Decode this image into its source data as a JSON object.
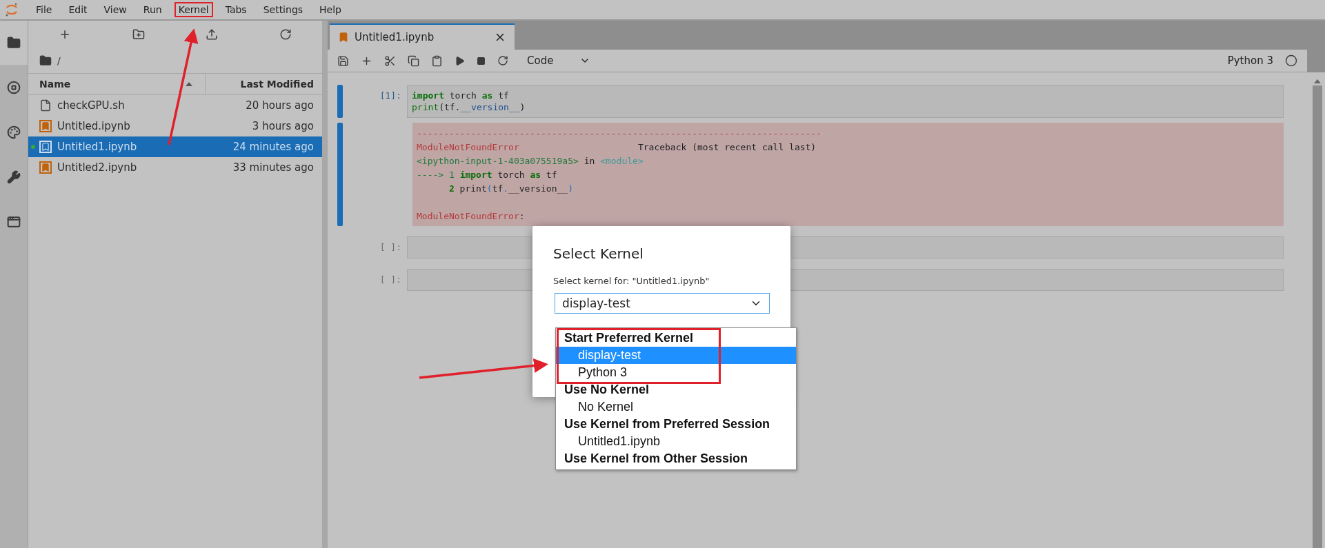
{
  "menu": [
    {
      "label": "File",
      "highlighted": false
    },
    {
      "label": "Edit",
      "highlighted": false
    },
    {
      "label": "View",
      "highlighted": false
    },
    {
      "label": "Run",
      "highlighted": false
    },
    {
      "label": "Kernel",
      "highlighted": true
    },
    {
      "label": "Tabs",
      "highlighted": false
    },
    {
      "label": "Settings",
      "highlighted": false
    },
    {
      "label": "Help",
      "highlighted": false
    }
  ],
  "rail": [
    {
      "kind": "folder",
      "selected": true
    },
    {
      "kind": "running",
      "selected": false
    },
    {
      "kind": "palette",
      "selected": false
    },
    {
      "kind": "tools",
      "selected": false
    },
    {
      "kind": "tabs",
      "selected": false
    }
  ],
  "file_browser": {
    "path": "/",
    "columns": [
      "Name",
      "Last Modified"
    ],
    "rows": [
      {
        "kind": "file",
        "name": "checkGPU.sh",
        "modified": "20 hours ago",
        "selected": false,
        "running": false
      },
      {
        "kind": "notebook",
        "name": "Untitled.ipynb",
        "modified": "3 hours ago",
        "selected": false,
        "running": false
      },
      {
        "kind": "notebook",
        "name": "Untitled1.ipynb",
        "modified": "24 minutes ago",
        "selected": true,
        "running": true
      },
      {
        "kind": "notebook",
        "name": "Untitled2.ipynb",
        "modified": "33 minutes ago",
        "selected": false,
        "running": false
      }
    ]
  },
  "notebook": {
    "tab": "Untitled1.ipynb",
    "cell_type": "Code",
    "kernel": "Python 3",
    "kernel_busy": false,
    "cells": [
      {
        "prompt": "[1]:",
        "active": true,
        "code": [
          [
            {
              "text": "import",
              "kind": "kw"
            },
            {
              "text": " torch ",
              "kind": "plain"
            },
            {
              "text": "as",
              "kind": "kw"
            },
            {
              "text": " tf",
              "kind": "plain"
            }
          ],
          [
            {
              "text": "print",
              "kind": "builtin"
            },
            {
              "text": "(tf.",
              "kind": "plain"
            },
            {
              "text": "__version__",
              "kind": "dunder"
            },
            {
              "text": ")",
              "kind": "plain"
            }
          ]
        ],
        "output": [
          [
            {
              "text": "---------------------------------------------------------------------------",
              "kind": "err"
            }
          ],
          [
            {
              "text": "ModuleNotFoundError",
              "kind": "err"
            },
            {
              "text": "                      Traceback (most recent call last)",
              "kind": "plain"
            }
          ],
          [
            {
              "text": "<ipython-input-1-403a075519a5>",
              "kind": "path"
            },
            {
              "text": " in ",
              "kind": "plain"
            },
            {
              "text": "<module>",
              "kind": "cyan"
            }
          ],
          [
            {
              "text": "----> 1 ",
              "kind": "path"
            },
            {
              "text": "import",
              "kind": "kw"
            },
            {
              "text": " torch ",
              "kind": "plain"
            },
            {
              "text": "as",
              "kind": "kw"
            },
            {
              "text": " tf",
              "kind": "plain"
            }
          ],
          [
            {
              "text": "      2",
              "kind": "kw"
            },
            {
              "text": " print",
              "kind": "plain"
            },
            {
              "text": "(",
              "kind": "paren"
            },
            {
              "text": "tf",
              "kind": "plain"
            },
            {
              "text": ".",
              "kind": "paren"
            },
            {
              "text": "__version__",
              "kind": "plain"
            },
            {
              "text": ")",
              "kind": "paren"
            }
          ]
        ],
        "error_summary": [
          {
            "text": "ModuleNotFoundError",
            "kind": "err"
          },
          {
            "text": ":",
            "kind": "plain"
          }
        ]
      },
      {
        "prompt": "[ ]:",
        "active": false
      },
      {
        "prompt": "[ ]:",
        "active": false
      }
    ]
  },
  "dialog": {
    "title": "Select Kernel",
    "label": "Select kernel for: \"Untitled1.ipynb\"",
    "value": "display-test",
    "groups": [
      {
        "label": "Start Preferred Kernel",
        "highlighted": true,
        "options": [
          {
            "label": "display-test",
            "selected": true
          },
          {
            "label": "Python 3",
            "selected": false
          }
        ]
      },
      {
        "label": "Use No Kernel",
        "highlighted": false,
        "options": [
          {
            "label": "No Kernel",
            "selected": false
          }
        ]
      },
      {
        "label": "Use Kernel from Preferred Session",
        "highlighted": false,
        "options": [
          {
            "label": "Untitled1.ipynb",
            "selected": false
          }
        ]
      },
      {
        "label": "Use Kernel from Other Session",
        "highlighted": false
      }
    ]
  }
}
